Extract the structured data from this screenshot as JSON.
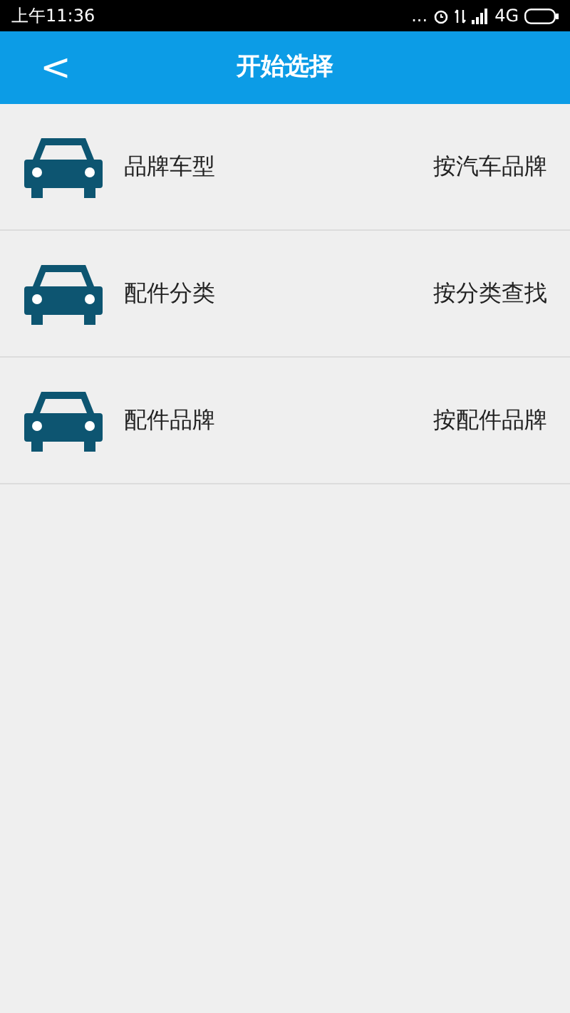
{
  "status_bar": {
    "time": "上午11:36",
    "more": "...",
    "network": "4G"
  },
  "header": {
    "back": "<",
    "title": "开始选择"
  },
  "items": [
    {
      "label": "品牌车型",
      "hint": "按汽车品牌"
    },
    {
      "label": "配件分类",
      "hint": "按分类查找"
    },
    {
      "label": "配件品牌",
      "hint": "按配件品牌"
    }
  ]
}
